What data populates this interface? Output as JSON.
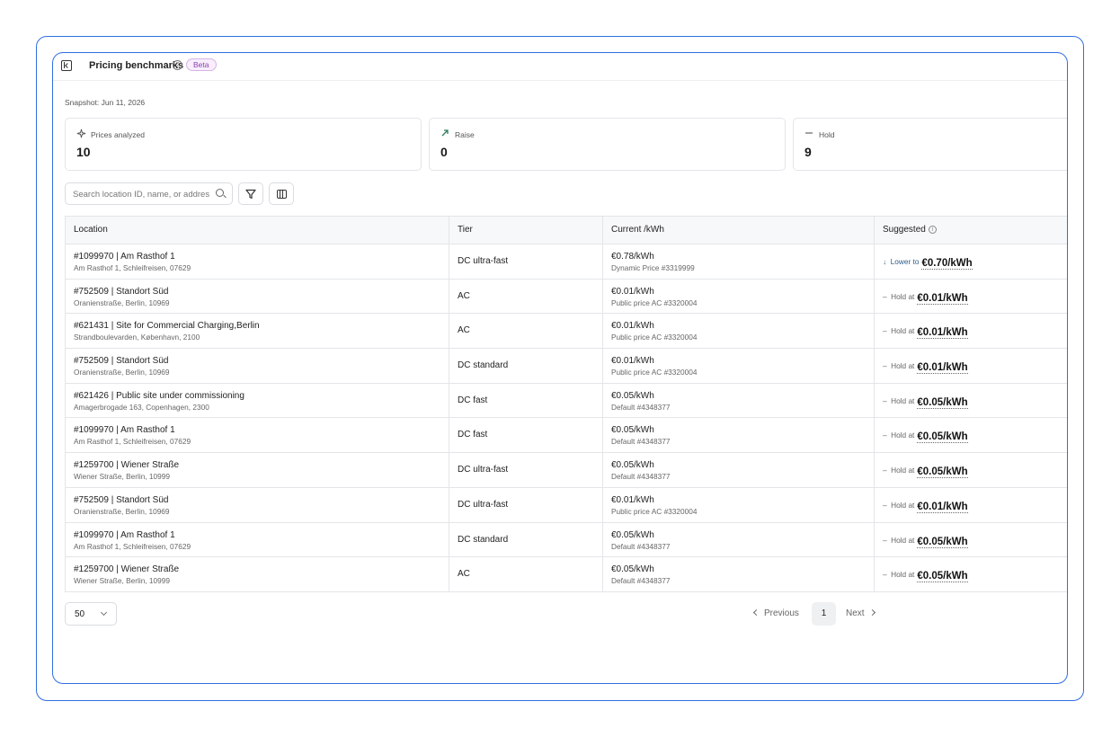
{
  "header": {
    "title": "Pricing benchmarks",
    "badge": "Beta"
  },
  "snapshot": "Snapshot: Jun 11, 2026",
  "stats": [
    {
      "label": "Prices analyzed",
      "value": "10",
      "icon": "sparkle-icon"
    },
    {
      "label": "Raise",
      "value": "0",
      "icon": "arrow-up-right-icon",
      "color": "#2e7d5b"
    },
    {
      "label": "Hold",
      "value": "9",
      "icon": "dash-icon"
    }
  ],
  "search": {
    "placeholder": "Search location ID, name, or address"
  },
  "table": {
    "columns": [
      "Location",
      "Tier",
      "Current /kWh",
      "Suggested"
    ],
    "rows": [
      {
        "name": "#1099970 | Am Rasthof 1",
        "address": "Am Rasthof 1, Schleifreisen, 07629",
        "tier": "DC ultra-fast",
        "current": "€0.78/kWh",
        "source": "Dynamic Price  #3319999",
        "action": "Lower to",
        "suggested": "€0.70/kWh"
      },
      {
        "name": "#752509 | Standort Süd",
        "address": "Oranienstraße, Berlin, 10969",
        "tier": "AC",
        "current": "€0.01/kWh",
        "source": "Public price AC  #3320004",
        "action": "Hold at",
        "suggested": "€0.01/kWh"
      },
      {
        "name": "#621431 | Site for Commercial Charging,Berlin",
        "address": "Strandboulevarden, København, 2100",
        "tier": "AC",
        "current": "€0.01/kWh",
        "source": "Public price AC  #3320004",
        "action": "Hold at",
        "suggested": "€0.01/kWh"
      },
      {
        "name": "#752509 | Standort Süd",
        "address": "Oranienstraße, Berlin, 10969",
        "tier": "DC standard",
        "current": "€0.01/kWh",
        "source": "Public price AC  #3320004",
        "action": "Hold at",
        "suggested": "€0.01/kWh"
      },
      {
        "name": "#621426 | Public site under commissioning",
        "address": "Amagerbrogade 163, Copenhagen, 2300",
        "tier": "DC fast",
        "current": "€0.05/kWh",
        "source": "Default  #4348377",
        "action": "Hold at",
        "suggested": "€0.05/kWh"
      },
      {
        "name": "#1099970 | Am Rasthof 1",
        "address": "Am Rasthof 1, Schleifreisen, 07629",
        "tier": "DC fast",
        "current": "€0.05/kWh",
        "source": "Default  #4348377",
        "action": "Hold at",
        "suggested": "€0.05/kWh"
      },
      {
        "name": "#1259700 | Wiener Straße",
        "address": "Wiener Straße, Berlin, 10999",
        "tier": "DC ultra-fast",
        "current": "€0.05/kWh",
        "source": "Default  #4348377",
        "action": "Hold at",
        "suggested": "€0.05/kWh"
      },
      {
        "name": "#752509 | Standort Süd",
        "address": "Oranienstraße, Berlin, 10969",
        "tier": "DC ultra-fast",
        "current": "€0.01/kWh",
        "source": "Public price AC  #3320004",
        "action": "Hold at",
        "suggested": "€0.01/kWh"
      },
      {
        "name": "#1099970 | Am Rasthof 1",
        "address": "Am Rasthof 1, Schleifreisen, 07629",
        "tier": "DC standard",
        "current": "€0.05/kWh",
        "source": "Default  #4348377",
        "action": "Hold at",
        "suggested": "€0.05/kWh"
      },
      {
        "name": "#1259700 | Wiener Straße",
        "address": "Wiener Straße, Berlin, 10999",
        "tier": "AC",
        "current": "€0.05/kWh",
        "source": "Default  #4348377",
        "action": "Hold at",
        "suggested": "€0.05/kWh"
      }
    ]
  },
  "pagination": {
    "page_size": "50",
    "previous": "Previous",
    "page": "1",
    "next": "Next"
  },
  "colors": {
    "accent": "#2f6fe0",
    "badge": "#8b3fb5",
    "lower": "#2d5d8a"
  }
}
